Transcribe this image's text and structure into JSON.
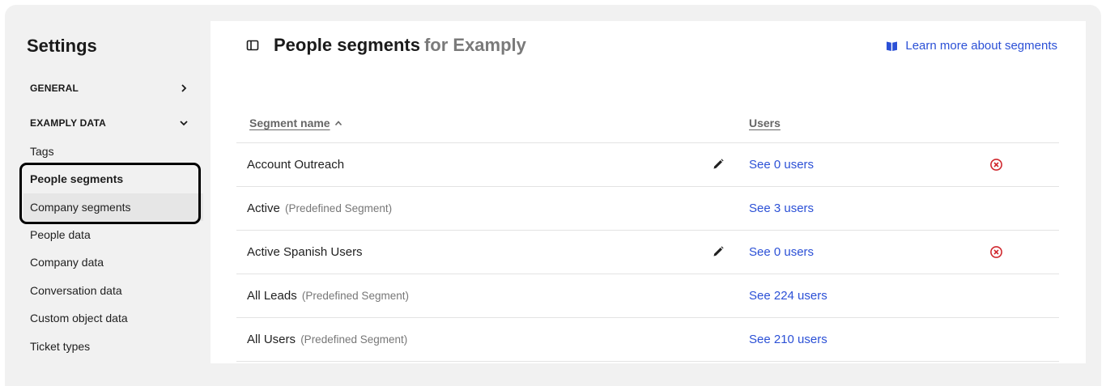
{
  "sidebar": {
    "title": "Settings",
    "sections": [
      {
        "label": "GENERAL",
        "chevron": "chevron-right-icon"
      },
      {
        "label": "EXAMPLY DATA",
        "chevron": "chevron-down-icon"
      }
    ],
    "items": [
      {
        "label": "Tags"
      },
      {
        "label": "People segments",
        "active": true
      },
      {
        "label": "Company segments"
      },
      {
        "label": "People data"
      },
      {
        "label": "Company data"
      },
      {
        "label": "Conversation data"
      },
      {
        "label": "Custom object data"
      },
      {
        "label": "Ticket types"
      }
    ]
  },
  "header": {
    "panel_icon": "panel-toggle-icon",
    "title": "People segments",
    "title_suffix": "for Examply",
    "learn_more": "Learn more about segments",
    "learn_more_icon": "book-icon"
  },
  "table": {
    "columns": {
      "name": "Segment name",
      "users": "Users"
    },
    "rows": [
      {
        "name": "Account Outreach",
        "note": "",
        "users": "See 0 users",
        "editable": true,
        "deletable": true
      },
      {
        "name": "Active",
        "note": "(Predefined Segment)",
        "users": "See 3 users",
        "editable": false,
        "deletable": false
      },
      {
        "name": "Active Spanish Users",
        "note": "",
        "users": "See 0 users",
        "editable": true,
        "deletable": true
      },
      {
        "name": "All Leads",
        "note": "(Predefined Segment)",
        "users": "See 224 users",
        "editable": false,
        "deletable": false
      },
      {
        "name": "All Users",
        "note": "(Predefined Segment)",
        "users": "See 210 users",
        "editable": false,
        "deletable": false
      }
    ]
  },
  "colors": {
    "link": "#2b50d6",
    "delete": "#d0282e",
    "sidebar_bg": "#f1f1f1"
  }
}
